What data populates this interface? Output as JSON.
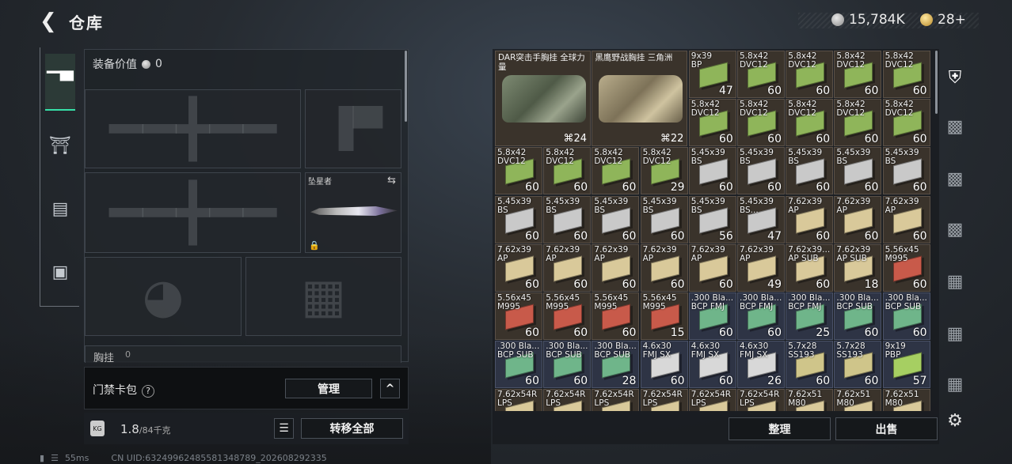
{
  "header": {
    "back_icon": "back-arrow-icon",
    "title": "仓库",
    "silver": "15,784K",
    "gold": "28+"
  },
  "tabs": [
    {
      "icon": "weapon-icon",
      "active": true
    },
    {
      "icon": "armor-icon",
      "active": false
    },
    {
      "icon": "backpack-icon",
      "active": false
    },
    {
      "icon": "briefcase-icon",
      "active": false
    }
  ],
  "loadout": {
    "value_label": "装备价值",
    "value": "0",
    "melee_name": "坠星者",
    "chest_label": "胸挂",
    "chest_value": "0"
  },
  "cardbag": {
    "label": "门禁卡包",
    "help": "?",
    "manage": "管理",
    "collapse": "^"
  },
  "capacity": {
    "weight": "1.8",
    "max": "/84千克",
    "transfer_all": "转移全部"
  },
  "status": {
    "ping": "55ms",
    "uid": "CN UID:6324996248558134878​9_202608292335"
  },
  "stash": {
    "bags": [
      {
        "name": "DAR突击手胸挂\n全球力量",
        "count": "24",
        "style": "g"
      },
      {
        "name": "黑鹰野战胸挂\n三角洲",
        "count": "22",
        "style": "t"
      }
    ],
    "cells": [
      {
        "n": "9x39\nBP",
        "q": "47",
        "c": "#8fb55a"
      },
      {
        "n": "5.8x42\nDVC12",
        "q": "60",
        "c": "#8fb55a"
      },
      {
        "n": "5.8x42\nDVC12",
        "q": "60",
        "c": "#8fb55a"
      },
      {
        "n": "5.8x42\nDVC12",
        "q": "60",
        "c": "#8fb55a"
      },
      {
        "n": "5.8x42\nDVC12",
        "q": "60",
        "c": "#8fb55a"
      },
      {
        "n": "5.8x42\nDVC12",
        "q": "60",
        "c": "#8fb55a"
      },
      {
        "n": "5.8x42\nDVC12",
        "q": "60",
        "c": "#8fb55a"
      },
      {
        "n": "5.8x42\nDVC12",
        "q": "60",
        "c": "#8fb55a"
      },
      {
        "n": "5.8x42\nDVC12",
        "q": "60",
        "c": "#8fb55a"
      },
      {
        "n": "5.8x42\nDVC12",
        "q": "60",
        "c": "#8fb55a"
      },
      {
        "n": "5.8x42\nDVC12",
        "q": "60",
        "c": "#8fb55a"
      },
      {
        "n": "5.8x42\nDVC12",
        "q": "60",
        "c": "#8fb55a"
      },
      {
        "n": "5.8x42\nDVC12",
        "q": "60",
        "c": "#8fb55a"
      },
      {
        "n": "5.8x42\nDVC12",
        "q": "29",
        "c": "#8fb55a"
      },
      {
        "n": "5.45x39\nBS",
        "q": "60",
        "c": "#c9c9c9"
      },
      {
        "n": "5.45x39\nBS",
        "q": "60",
        "c": "#c9c9c9"
      },
      {
        "n": "5.45x39\nBS",
        "q": "60",
        "c": "#c9c9c9"
      },
      {
        "n": "5.45x39\nBS",
        "q": "60",
        "c": "#c9c9c9"
      },
      {
        "n": "5.45x39\nBS",
        "q": "60",
        "c": "#c9c9c9"
      },
      {
        "n": "5.45x39\nBS",
        "q": "60",
        "c": "#c9c9c9"
      },
      {
        "n": "5.45x39\nBS",
        "q": "60",
        "c": "#c9c9c9"
      },
      {
        "n": "5.45x39\nBS",
        "q": "60",
        "c": "#c9c9c9"
      },
      {
        "n": "5.45x39\nBS",
        "q": "60",
        "c": "#c9c9c9"
      },
      {
        "n": "5.45x39\nBS",
        "q": "56",
        "c": "#c9c9c9"
      },
      {
        "n": "5.45x39\nBS...",
        "q": "47",
        "c": "#c9c9c9"
      },
      {
        "n": "7.62x39\nAP",
        "q": "60",
        "c": "#d9c99a"
      },
      {
        "n": "7.62x39\nAP",
        "q": "60",
        "c": "#d9c99a"
      },
      {
        "n": "7.62x39\nAP",
        "q": "60",
        "c": "#d9c99a"
      },
      {
        "n": "7.62x39\nAP",
        "q": "60",
        "c": "#d9c99a"
      },
      {
        "n": "7.62x39\nAP",
        "q": "60",
        "c": "#d9c99a"
      },
      {
        "n": "7.62x39\nAP",
        "q": "60",
        "c": "#d9c99a"
      },
      {
        "n": "7.62x39\nAP",
        "q": "60",
        "c": "#d9c99a"
      },
      {
        "n": "7.62x39\nAP",
        "q": "60",
        "c": "#d9c99a"
      },
      {
        "n": "7.62x39\nAP",
        "q": "49",
        "c": "#d9c99a"
      },
      {
        "n": "7.62x39...\nAP SUB",
        "q": "60",
        "c": "#d9c99a"
      },
      {
        "n": "7.62x39\nAP SUB",
        "q": "18",
        "c": "#d9c99a"
      },
      {
        "n": "5.56x45\nM995",
        "q": "60",
        "c": "#c85a4a"
      },
      {
        "n": "5.56x45\nM995",
        "q": "60",
        "c": "#c85a4a"
      },
      {
        "n": "5.56x45\nM995",
        "q": "60",
        "c": "#c85a4a"
      },
      {
        "n": "5.56x45\nM995",
        "q": "60",
        "c": "#c85a4a"
      },
      {
        "n": "5.56x45\nM995",
        "q": "15",
        "c": "#c85a4a"
      },
      {
        "n": ".300 Bla...\nBCP FMJ",
        "q": "60",
        "c": "#6fb58a",
        "b": 1
      },
      {
        "n": ".300 Bla...\nBCP FMJ",
        "q": "60",
        "c": "#6fb58a",
        "b": 1
      },
      {
        "n": ".300 Bla...\nBCP FMJ",
        "q": "25",
        "c": "#6fb58a",
        "b": 1
      },
      {
        "n": ".300 Bla...\nBCP SUB",
        "q": "60",
        "c": "#6fb58a",
        "b": 1
      },
      {
        "n": ".300 Bla...\nBCP SUB",
        "q": "60",
        "c": "#6fb58a",
        "b": 1
      },
      {
        "n": ".300 Bla...\nBCP SUB",
        "q": "60",
        "c": "#6fb58a",
        "b": 1
      },
      {
        "n": ".300 Bla...\nBCP SUB",
        "q": "60",
        "c": "#6fb58a",
        "b": 1
      },
      {
        "n": ".300 Bla...\nBCP SUB",
        "q": "28",
        "c": "#6fb58a",
        "b": 1
      },
      {
        "n": "4.6x30\nFMJ SX",
        "q": "60",
        "c": "#d8d8d8",
        "b": 1
      },
      {
        "n": "4.6x30\nFMJ SX",
        "q": "60",
        "c": "#d8d8d8",
        "b": 1
      },
      {
        "n": "4.6x30\nFMJ SX",
        "q": "26",
        "c": "#d8d8d8",
        "b": 1
      },
      {
        "n": "5.7x28\nSS193",
        "q": "60",
        "c": "#cfc58a",
        "b": 1
      },
      {
        "n": "5.7x28\nSS193",
        "q": "60",
        "c": "#cfc58a",
        "b": 1
      },
      {
        "n": "9x19\nPBP",
        "q": "57",
        "c": "#a6cf62",
        "b": 1
      },
      {
        "n": "7.62x54R\nLPS",
        "q": "",
        "c": "#d9c99a"
      },
      {
        "n": "7.62x54R\nLPS",
        "q": "",
        "c": "#d9c99a"
      },
      {
        "n": "7.62x54R\nLPS",
        "q": "",
        "c": "#d9c99a"
      },
      {
        "n": "7.62x54R\nLPS",
        "q": "",
        "c": "#d9c99a"
      },
      {
        "n": "7.62x54R\nLPS",
        "q": "",
        "c": "#d9c99a"
      },
      {
        "n": "7.62x54R\nLPS",
        "q": "",
        "c": "#d9c99a"
      },
      {
        "n": "7.62x51\nM80",
        "q": "",
        "c": "#d9c99a"
      },
      {
        "n": "7.62x51\nM80",
        "q": "",
        "c": "#d9c99a"
      },
      {
        "n": "7.62x51\nM80",
        "q": "",
        "c": "#d9c99a"
      }
    ]
  },
  "actions": {
    "sort": "整理",
    "sell": "出售"
  },
  "side_icons": [
    "backpack-icon",
    "weapon-case-icon",
    "weapon-case-icon",
    "weapon-case-icon",
    "storage-icon",
    "storage-icon",
    "storage-icon",
    "settings-icon"
  ]
}
